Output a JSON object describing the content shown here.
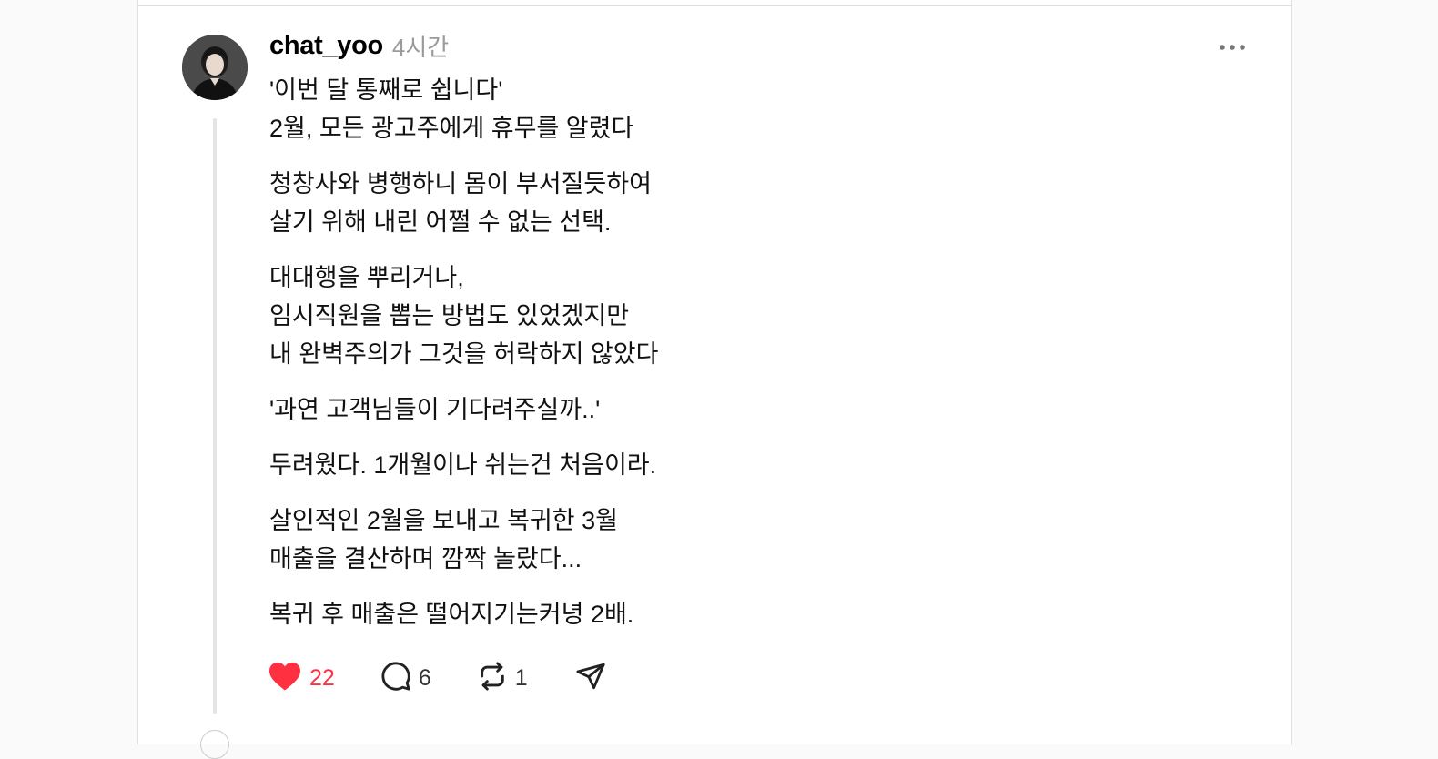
{
  "post": {
    "username": "chat_yoo",
    "timestamp": "4시간",
    "paragraphs": [
      {
        "lines": [
          "'이번 달 통째로 쉽니다'",
          "2월, 모든 광고주에게 휴무를 알렸다"
        ]
      },
      {
        "lines": [
          "청창사와 병행하니 몸이 부서질듯하여",
          "살기 위해 내린 어쩔 수 없는 선택."
        ]
      },
      {
        "lines": [
          "대대행을 뿌리거나,",
          "임시직원을 뽑는 방법도 있었겠지만",
          "내 완벽주의가 그것을 허락하지 않았다"
        ]
      },
      {
        "lines": [
          "'과연 고객님들이 기다려주실까..'"
        ]
      },
      {
        "lines": [
          "두려웠다. 1개월이나 쉬는건 처음이라."
        ]
      },
      {
        "lines": [
          "살인적인 2월을 보내고 복귀한 3월",
          "매출을 결산하며 깜짝 놀랐다..."
        ]
      },
      {
        "lines": [
          "복귀 후 매출은 떨어지기는커녕 2배."
        ]
      }
    ],
    "actions": {
      "likes": "22",
      "replies": "6",
      "reposts": "1"
    }
  },
  "icons": {
    "more": "more-horizontal-icon",
    "like": "heart-filled-icon",
    "reply": "comment-icon",
    "repost": "repost-icon",
    "share": "send-icon"
  },
  "colors": {
    "like_active": "#ff3040",
    "muted_text": "#9a9a9a",
    "thread_line": "#e4e4e4"
  }
}
